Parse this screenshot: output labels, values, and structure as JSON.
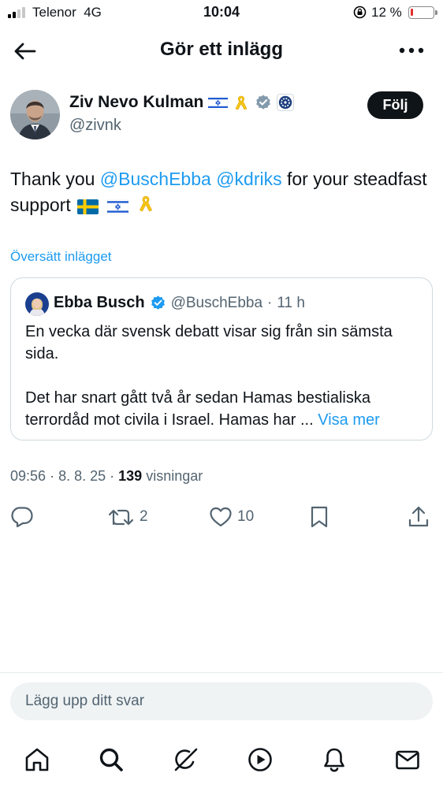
{
  "status_bar": {
    "carrier": "Telenor",
    "network": "4G",
    "time": "10:04",
    "battery_pct": "12 %",
    "battery_level": 0.12,
    "battery_color": "#e5302c"
  },
  "header": {
    "title": "Gör ett inlägg",
    "back_icon": "arrow-left-icon",
    "more_icon": "more-horizontal-icon"
  },
  "post": {
    "author": {
      "name": "Ziv Nevo Kulman",
      "handle": "@zivnk",
      "badges": [
        "israel-flag-icon",
        "yellow-ribbon-icon",
        "gray-verified-icon",
        "government-affiliation-icon"
      ]
    },
    "follow_label": "Följ",
    "text": {
      "prefix": "Thank you ",
      "mention1": "@BuschEbba",
      "space": " ",
      "mention2": "@kdriks",
      "suffix": " for your steadfast support",
      "emojis": [
        "sweden-flag-icon",
        "israel-flag-icon",
        "yellow-ribbon-icon"
      ]
    },
    "translate_label": "Översätt inlägget",
    "quote": {
      "name": "Ebba Busch",
      "handle": "@BuschEbba",
      "separator": "·",
      "age": "11 h",
      "paragraph1": "En vecka där svensk debatt visar sig från sin sämsta sida.",
      "paragraph2": "Det har snart gått två år sedan Hamas bestialiska terrordåd mot civila i Israel. Hamas har ...",
      "show_more": "Visa mer"
    },
    "meta": {
      "time": "09:56",
      "sep1": "·",
      "date": "8. 8. 25",
      "sep2": "·",
      "views": "139",
      "views_label": "visningar"
    },
    "actions": {
      "reply_count": "",
      "retweet_count": "2",
      "like_count": "10"
    }
  },
  "reply_placeholder": "Lägg upp ditt svar",
  "bottom_nav": [
    "home-icon",
    "search-icon",
    "grok-icon",
    "video-icon",
    "notifications-icon",
    "messages-icon"
  ],
  "colors": {
    "accent": "#1d9bf0",
    "text": "#0f1419",
    "secondary": "#536471",
    "border": "#cfd9de",
    "reply_bg": "#eff3f4"
  }
}
